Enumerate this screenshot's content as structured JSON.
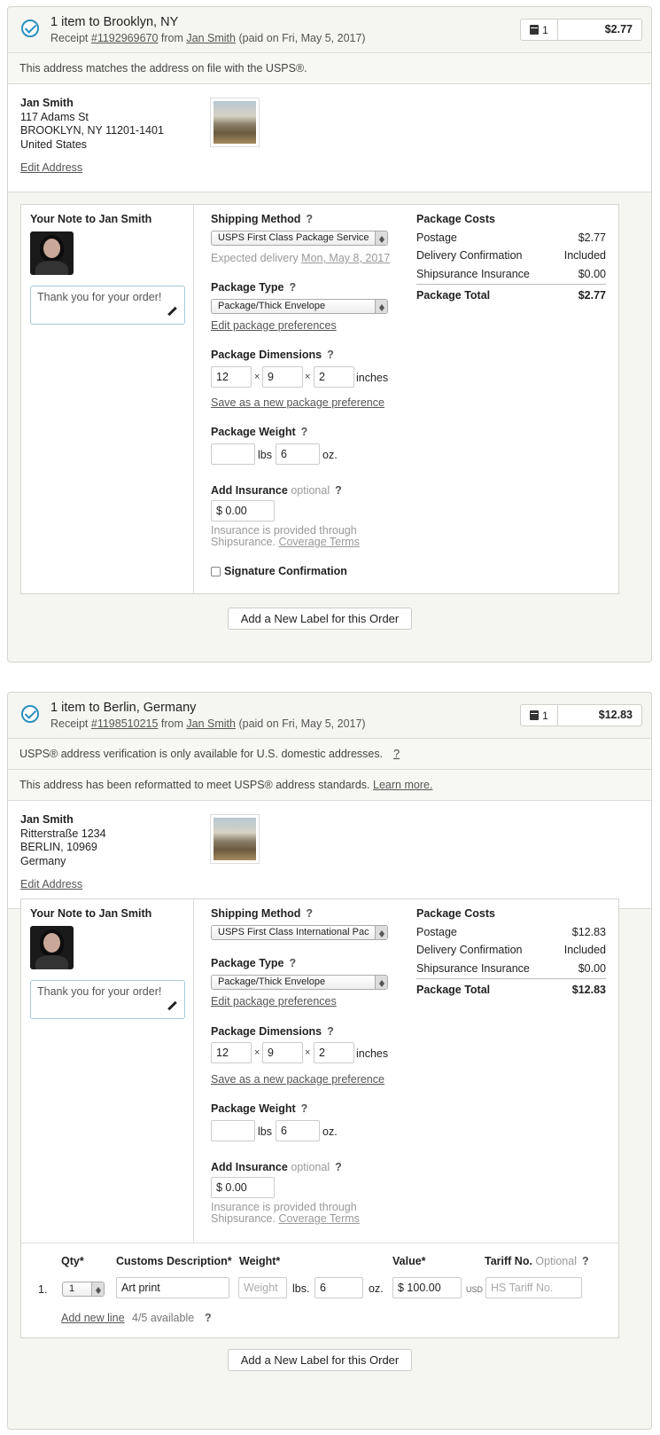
{
  "orders": [
    {
      "title": "1 item to Brooklyn, NY",
      "receipt_prefix": "Receipt",
      "receipt_no": "#1192969670",
      "from_word": "from",
      "buyer": "Jan Smith",
      "paid": "(paid on Fri, May 5, 2017)",
      "item_count": "1",
      "total": "$2.77",
      "notices": [
        "This address matches the address on file with the USPS®."
      ],
      "address": [
        "Jan Smith",
        "117 Adams St",
        "BROOKLYN, NY 11201-1401",
        "United States"
      ],
      "edit_address": "Edit Address",
      "note_title": "Your Note to Jan Smith",
      "note_text": "Thank you for your order!",
      "shipping_method_label": "Shipping Method",
      "shipping_method": "USPS First Class Package Service",
      "expected_prefix": "Expected delivery",
      "expected_date": "Mon, May 8, 2017",
      "package_type_label": "Package Type",
      "package_type": "Package/Thick Envelope",
      "edit_prefs": "Edit package preferences",
      "dimensions_label": "Package Dimensions",
      "dims": [
        "12",
        "9",
        "2"
      ],
      "dims_unit": "inches",
      "save_pref": "Save as a new package preference",
      "weight_label": "Package Weight",
      "lbs_value": "",
      "lbs_unit": "lbs",
      "oz_value": "6",
      "oz_unit": "oz.",
      "insurance_label": "Add Insurance",
      "optional": "optional",
      "insurance_value": "$ 0.00",
      "insurance_note_1": "Insurance is provided through",
      "insurance_note_2": "Shipsurance.",
      "coverage_terms": "Coverage Terms",
      "signature": "Signature Confirmation",
      "costs_title": "Package Costs",
      "costs": [
        {
          "label": "Postage",
          "value": "$2.77"
        },
        {
          "label": "Delivery Confirmation",
          "value": "Included"
        },
        {
          "label": "Shipsurance Insurance",
          "value": "$0.00"
        }
      ],
      "total_label": "Package Total",
      "total_value": "$2.77",
      "add_label": "Add a New Label for this Order"
    },
    {
      "title": "1 item to Berlin, Germany",
      "receipt_prefix": "Receipt",
      "receipt_no": "#1198510215",
      "from_word": "from",
      "buyer": "Jan Smith",
      "paid": "(paid on Fri, May 5, 2017)",
      "item_count": "1",
      "total": "$12.83",
      "notices": [
        "USPS® address verification is only available for U.S. domestic addresses.",
        "This address has been reformatted to meet USPS® address standards."
      ],
      "notice_q": "?",
      "learn_more": "Learn more.",
      "address": [
        "Jan Smith",
        "Ritterstraße 1234",
        "BERLIN, 10969",
        "Germany"
      ],
      "edit_address": "Edit Address",
      "note_title": "Your Note to Jan Smith",
      "note_text": "Thank you for your order!",
      "shipping_method_label": "Shipping Method",
      "shipping_method": "USPS First Class International Pac",
      "package_type_label": "Package Type",
      "package_type": "Package/Thick Envelope",
      "edit_prefs": "Edit package preferences",
      "dimensions_label": "Package Dimensions",
      "dims": [
        "12",
        "9",
        "2"
      ],
      "dims_unit": "inches",
      "save_pref": "Save as a new package preference",
      "weight_label": "Package Weight",
      "lbs_value": "",
      "lbs_unit": "lbs",
      "oz_value": "6",
      "oz_unit": "oz.",
      "insurance_label": "Add Insurance",
      "optional": "optional",
      "insurance_value": "$ 0.00",
      "insurance_note_1": "Insurance is provided through",
      "insurance_note_2": "Shipsurance.",
      "coverage_terms": "Coverage Terms",
      "costs_title": "Package Costs",
      "costs": [
        {
          "label": "Postage",
          "value": "$12.83"
        },
        {
          "label": "Delivery Confirmation",
          "value": "Included"
        },
        {
          "label": "Shipsurance Insurance",
          "value": "$0.00"
        }
      ],
      "total_label": "Package Total",
      "total_value": "$12.83",
      "customs": {
        "headers": {
          "qty": "Qty*",
          "desc": "Customs Description*",
          "weight": "Weight*",
          "value": "Value*",
          "tariff": "Tariff No.",
          "tariff_opt": "Optional",
          "tariff_q": "?"
        },
        "row_no": "1.",
        "qty": "1",
        "desc": "Art print",
        "weight_placeholder": "Weight",
        "lbs": "lbs.",
        "oz_value": "6",
        "oz": "oz.",
        "value": "$ 100.00",
        "currency": "USD",
        "tariff_placeholder": "HS Tariff No.",
        "add_line": "Add new line",
        "available": "4/5 available",
        "available_q": "?"
      },
      "add_label": "Add a New Label for this Order"
    }
  ],
  "help_q": "?",
  "times_sign": "×",
  "colors": {
    "accent": "#2a8fbd",
    "panel": "#f5f5f1",
    "border": "#d4d4cf"
  }
}
